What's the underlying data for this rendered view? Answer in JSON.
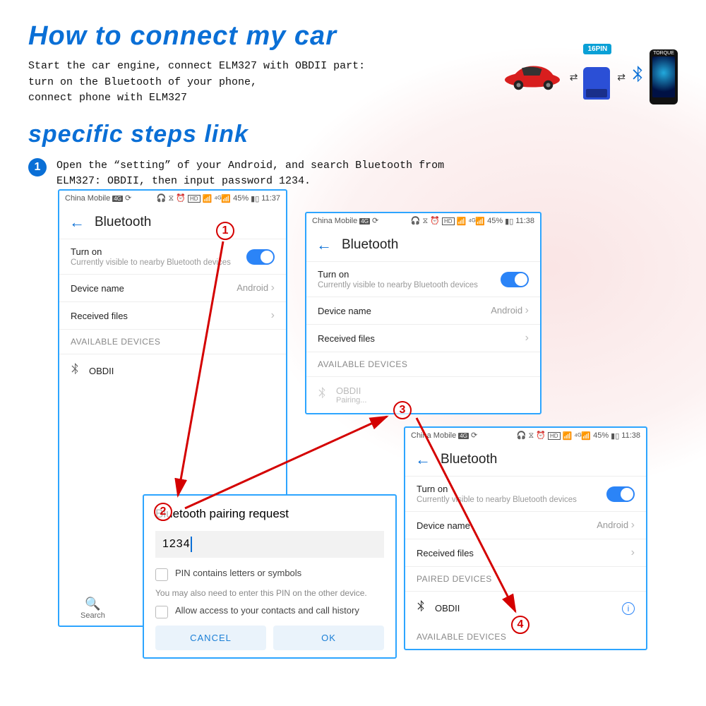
{
  "title": "How to connect my car",
  "intro_line1": "Start the car engine, connect ELM327 with OBDII part:",
  "intro_line2": "turn on the Bluetooth of your phone,",
  "intro_line3": "connect phone with ELM327",
  "subtitle": "specific steps link",
  "step1_num": "1",
  "step1_text": "Open the “setting” of your Android, and search Bluetooth from ELM327: OBDII, then input password 1234.",
  "diagram": {
    "pin_label": "16PIN",
    "phone_label": "TORQUE"
  },
  "status": {
    "carrier": "China Mobile",
    "battery": "45%",
    "time1": "11:37",
    "time2": "11:38",
    "hd": "HD"
  },
  "phone": {
    "header": "Bluetooth",
    "turn_on": "Turn on",
    "visible": "Currently visible to nearby Bluetooth devices",
    "device_name": "Device name",
    "device_value": "Android",
    "received": "Received files",
    "available": "AVAILABLE DEVICES",
    "paired": "PAIRED DEVICES",
    "obdii": "OBDII",
    "pairing": "Pairing...",
    "search": "Search"
  },
  "dialog": {
    "title": "Bluetooth pairing request",
    "pin": "1234",
    "pin_letters": "PIN contains letters or symbols",
    "hint": "You may also need to enter this PIN on the other device.",
    "allow": "Allow access to your contacts and call history",
    "cancel": "CANCEL",
    "ok": "OK"
  },
  "markers": {
    "m1": "1",
    "m2": "2",
    "m3": "3",
    "m4": "4"
  }
}
